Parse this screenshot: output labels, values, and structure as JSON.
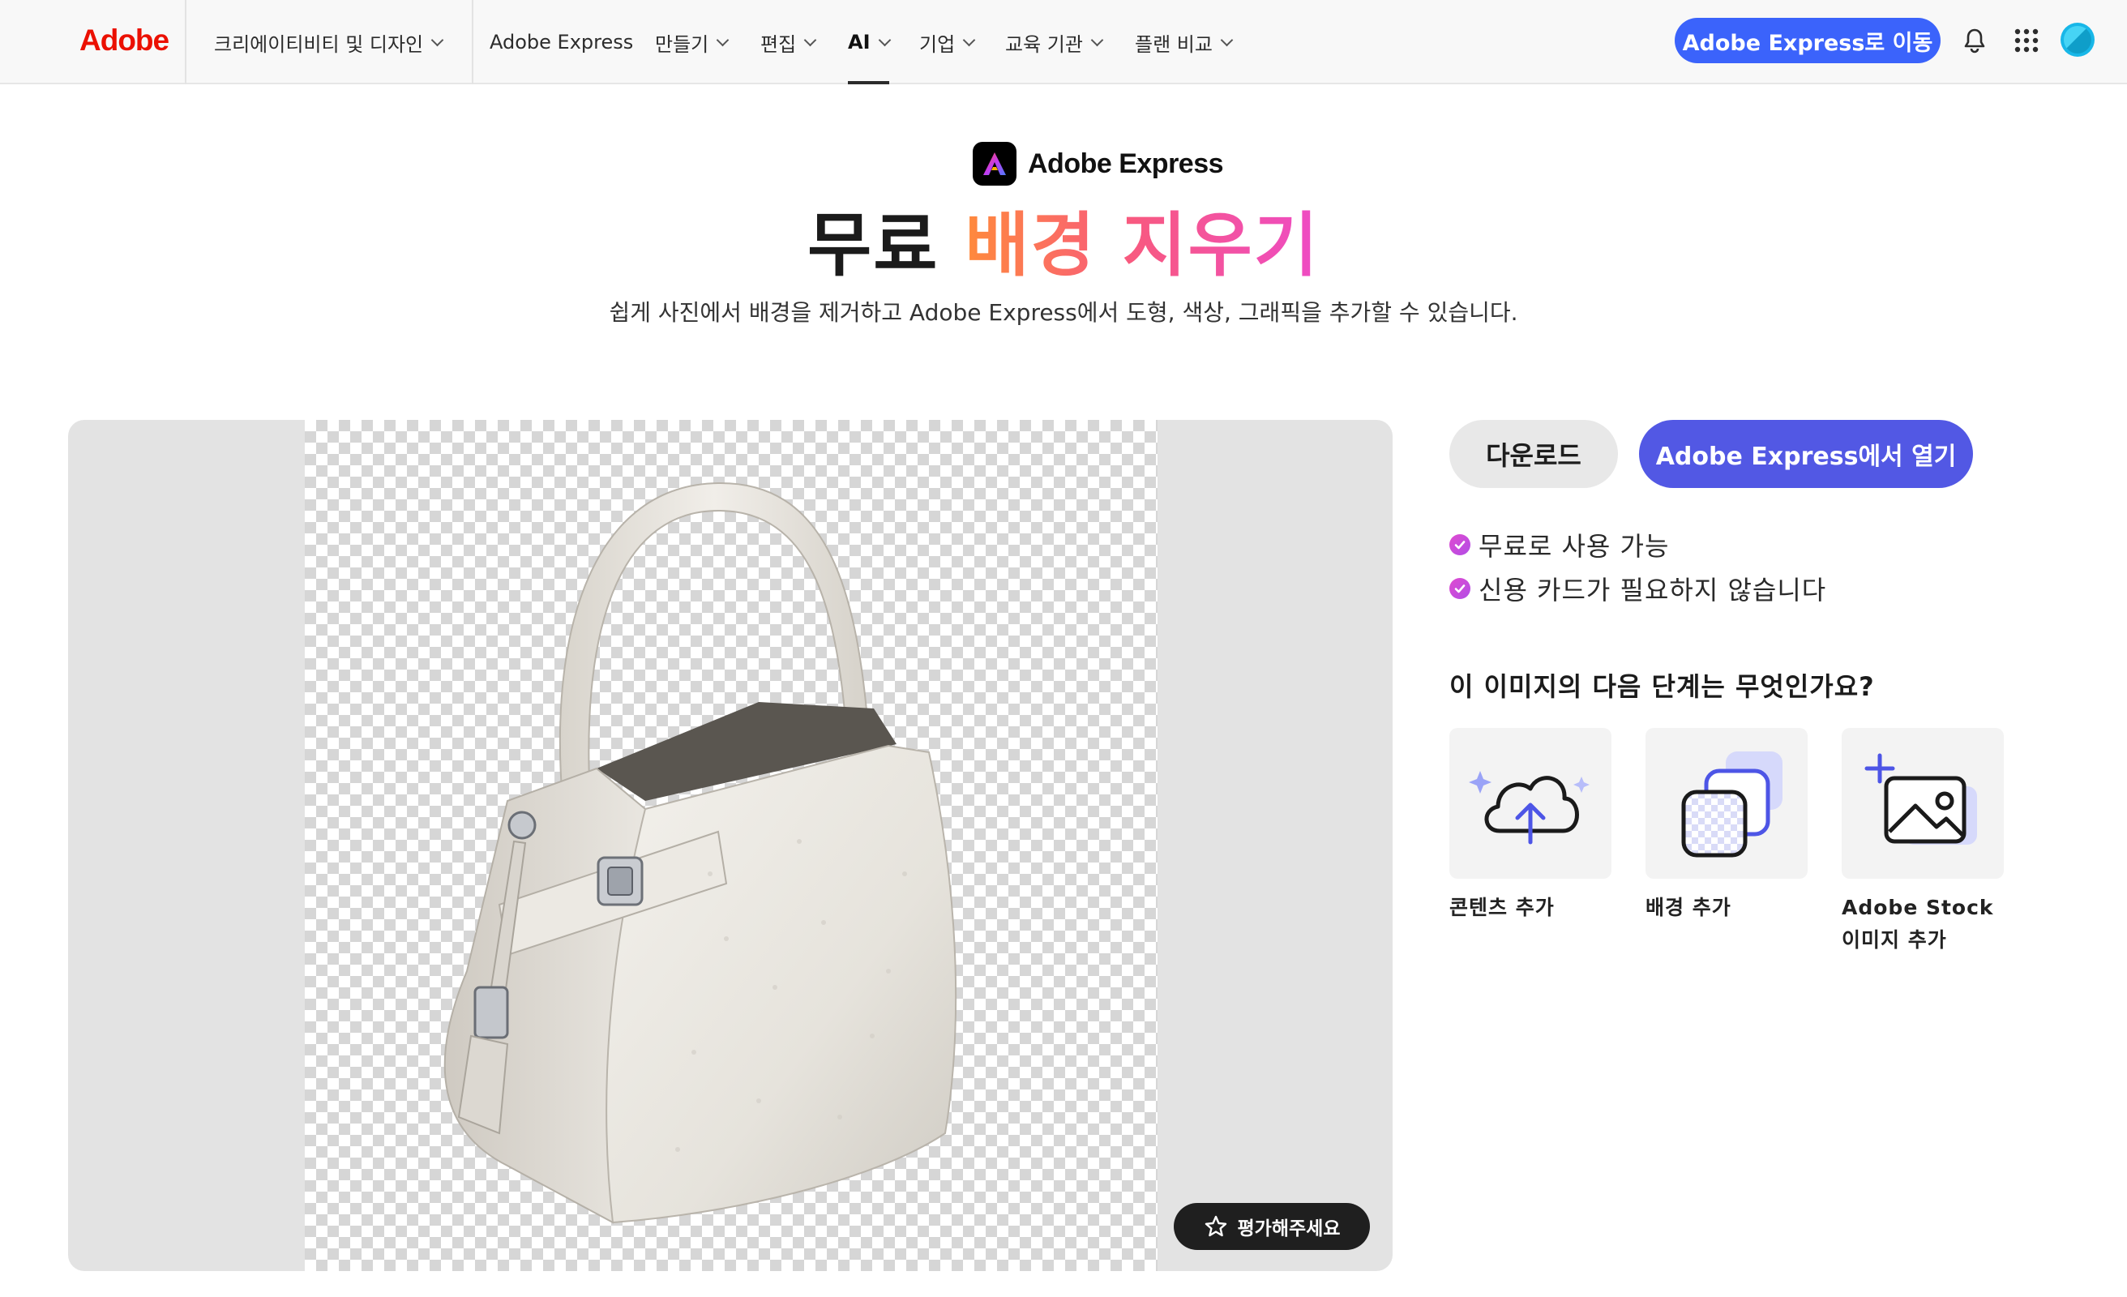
{
  "nav": {
    "logo": "Adobe",
    "items": [
      {
        "label": "크리에이티비티 및 디자인",
        "dropdown": true
      },
      {
        "label": "Adobe Express",
        "dropdown": false
      },
      {
        "label": "만들기",
        "dropdown": true
      },
      {
        "label": "편집",
        "dropdown": true
      },
      {
        "label": "AI",
        "dropdown": true,
        "active": true
      },
      {
        "label": "기업",
        "dropdown": true
      },
      {
        "label": "교육 기관",
        "dropdown": true
      },
      {
        "label": "플랜 비교",
        "dropdown": true
      }
    ],
    "cta": "Adobe Express로 이동",
    "icons": [
      "bell-icon",
      "app-grid-icon",
      "user-avatar"
    ]
  },
  "hero": {
    "brand": "Adobe Express",
    "title_plain": "무료",
    "title_highlight": "배경 지우기",
    "subtitle": "쉽게 사진에서 배경을 제거하고 Adobe Express에서 도형, 색상, 그래픽을 추가할 수 있습니다."
  },
  "preview": {
    "rate_button": "평가해주세요"
  },
  "actions": {
    "download": "다운로드",
    "open": "Adobe Express에서 열기"
  },
  "features": [
    "무료로 사용 가능",
    "신용 카드가 필요하지 않습니다"
  ],
  "next_steps": {
    "title": "이 이미지의 다음 단계는 무엇인가요?",
    "cards": [
      {
        "label": "콘텐츠 추가",
        "icon": "cloud-upload-icon"
      },
      {
        "label": "배경 추가",
        "icon": "layers-background-icon"
      },
      {
        "label": "Adobe Stock 이미지 추가",
        "icon": "add-image-icon"
      }
    ]
  },
  "colors": {
    "adobe_red": "#eb1000",
    "cta_blue": "#3b63fb",
    "open_purple": "#5258e4",
    "gradient_start": "#ff8a3c",
    "gradient_end": "#ee4bc5"
  }
}
